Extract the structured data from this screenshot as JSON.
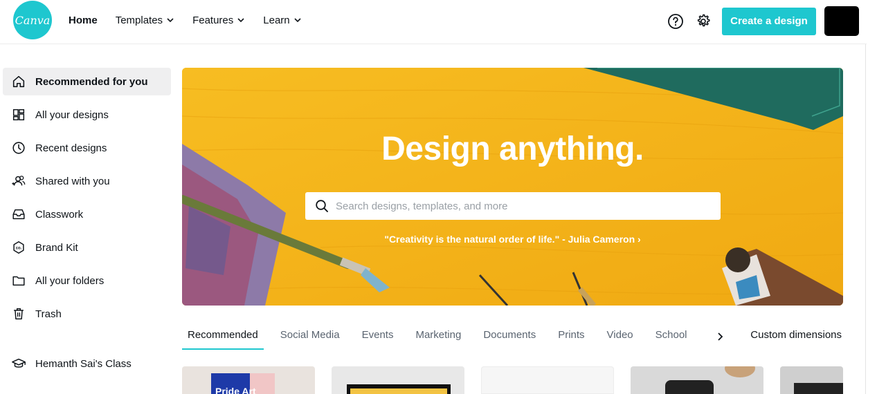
{
  "header": {
    "logo_text": "Canva",
    "nav": [
      {
        "label": "Home"
      },
      {
        "label": "Templates"
      },
      {
        "label": "Features"
      },
      {
        "label": "Learn"
      }
    ],
    "help_icon": "help-icon",
    "settings_icon": "gear-icon",
    "create_button": "Create a design"
  },
  "sidebar": {
    "items": [
      {
        "label": "Recommended for you",
        "icon": "home-icon"
      },
      {
        "label": "All your designs",
        "icon": "grid-icon"
      },
      {
        "label": "Recent designs",
        "icon": "clock-icon"
      },
      {
        "label": "Shared with you",
        "icon": "shared-users-icon"
      },
      {
        "label": "Classwork",
        "icon": "inbox-icon"
      },
      {
        "label": "Brand Kit",
        "icon": "brand-kit-icon"
      },
      {
        "label": "All your folders",
        "icon": "folder-icon"
      },
      {
        "label": "Trash",
        "icon": "trash-icon"
      }
    ],
    "class_item": {
      "label": "Hemanth Sai's Class",
      "icon": "graduation-cap-icon"
    }
  },
  "hero": {
    "title": "Design anything.",
    "search_placeholder": "Search designs, templates, and more",
    "quote": "\"Creativity is the natural order of life.\" - Julia Cameron ›"
  },
  "tabs": {
    "items": [
      {
        "label": "Recommended"
      },
      {
        "label": "Social Media"
      },
      {
        "label": "Events"
      },
      {
        "label": "Marketing"
      },
      {
        "label": "Documents"
      },
      {
        "label": "Prints"
      },
      {
        "label": "Video"
      },
      {
        "label": "School"
      }
    ],
    "custom": "Custom dimensions"
  },
  "cards": [
    {
      "label": "Pride Art"
    }
  ],
  "colors": {
    "brand": "#1ec7cf",
    "hero_bg": "#f4b51a"
  }
}
